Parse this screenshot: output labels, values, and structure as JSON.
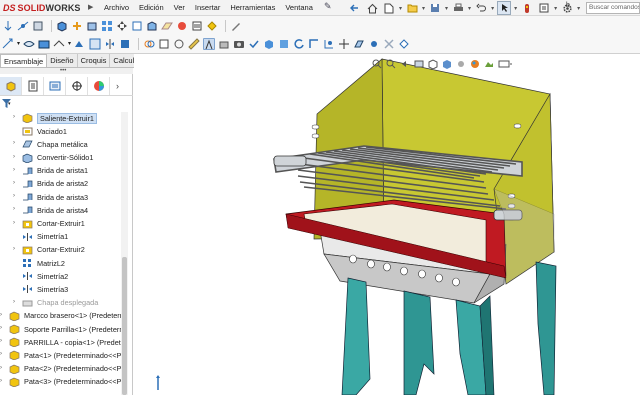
{
  "app": {
    "logo_prefix": "DS",
    "logo_name_a": "SOLID",
    "logo_name_b": "WORKS"
  },
  "menu": [
    "Archivo",
    "Edición",
    "Ver",
    "Insertar",
    "Herramientas",
    "Ventana"
  ],
  "search": {
    "placeholder": "Buscar comandos",
    "label_b": "b"
  },
  "tabs": [
    "Ensamblaje",
    "Diseño",
    "Croquis",
    "Calcular"
  ],
  "feature_tree": [
    {
      "label": "Saliente-Extruir1",
      "icon": "extrude-icon",
      "indent": 1,
      "expand": true,
      "selected": true
    },
    {
      "label": "Vaciado1",
      "icon": "shell-icon",
      "indent": 1,
      "expand": false
    },
    {
      "label": "Chapa metálica",
      "icon": "sheet-metal-icon",
      "indent": 1,
      "expand": true
    },
    {
      "label": "Convertir-Sólido1",
      "icon": "convert-solid-icon",
      "indent": 1,
      "expand": true
    },
    {
      "label": "Brida de arista1",
      "icon": "edge-flange-icon",
      "indent": 1,
      "expand": true
    },
    {
      "label": "Brida de arista2",
      "icon": "edge-flange-icon",
      "indent": 1,
      "expand": true
    },
    {
      "label": "Brida de arista3",
      "icon": "edge-flange-icon",
      "indent": 1,
      "expand": true
    },
    {
      "label": "Brida de arista4",
      "icon": "edge-flange-icon",
      "indent": 1,
      "expand": true
    },
    {
      "label": "Cortar-Extruir1",
      "icon": "cut-extrude-icon",
      "indent": 1,
      "expand": true
    },
    {
      "label": "Simetría1",
      "icon": "mirror-icon",
      "indent": 1,
      "expand": false
    },
    {
      "label": "Cortar-Extruir2",
      "icon": "cut-extrude-icon",
      "indent": 1,
      "expand": true
    },
    {
      "label": "MatrizL2",
      "icon": "linear-pattern-icon",
      "indent": 1,
      "expand": false
    },
    {
      "label": "Simetría2",
      "icon": "mirror-icon",
      "indent": 1,
      "expand": false
    },
    {
      "label": "Simetría3",
      "icon": "mirror-icon",
      "indent": 1,
      "expand": false
    },
    {
      "label": "Chapa desplegada",
      "icon": "flat-pattern-icon",
      "indent": 1,
      "expand": true,
      "grey": true
    },
    {
      "label": "Marcco brasero<1> (Predetern",
      "icon": "part-icon",
      "indent": 0,
      "expand": true
    },
    {
      "label": "Soporte Parrilla<1> (Predeterm",
      "icon": "part-icon",
      "indent": 0,
      "expand": true
    },
    {
      "label": "PARRILLA - copia<1> (Predete",
      "icon": "part-icon",
      "indent": 0,
      "expand": true
    },
    {
      "label": "Pata<1> (Predeterminado<<P",
      "icon": "part-icon",
      "indent": 0,
      "expand": true
    },
    {
      "label": "Pata<2> (Predeterminado<<P",
      "icon": "part-icon",
      "indent": 0,
      "expand": true
    },
    {
      "label": "Pata<3> (Predeterminado<<P",
      "icon": "part-icon",
      "indent": 0,
      "expand": true
    }
  ],
  "colors": {
    "body_yellow": "#c8c832",
    "frame_red": "#c01a22",
    "legs_teal": "#3aa8a4",
    "box_grey": "#c8c8c8",
    "grill_grey": "#9aa0a6"
  }
}
